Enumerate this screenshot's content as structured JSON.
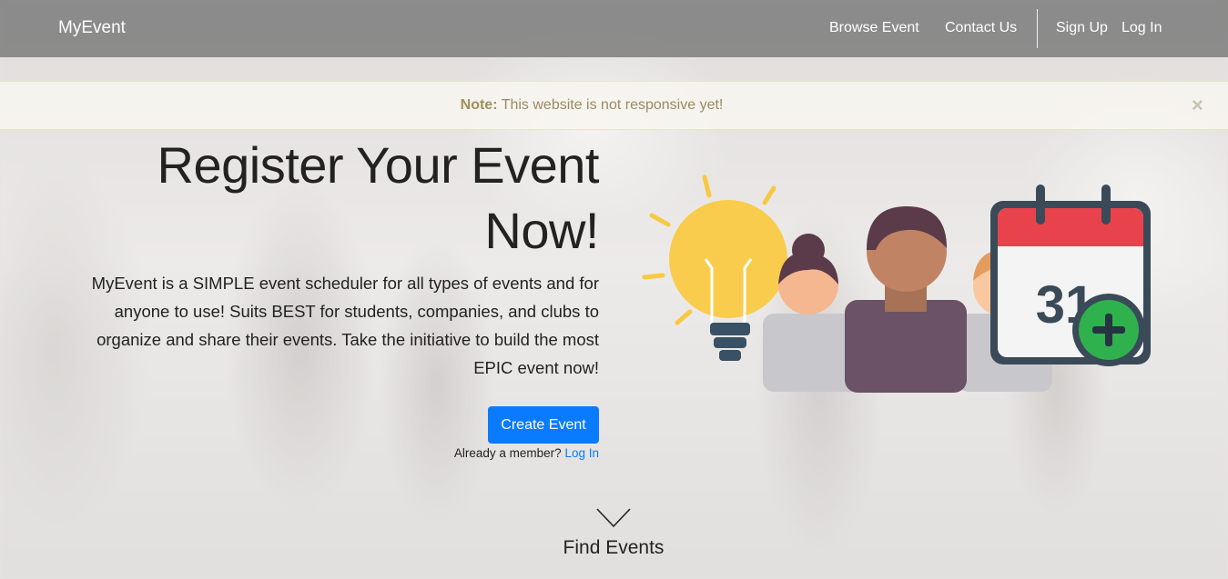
{
  "navbar": {
    "brand": "MyEvent",
    "links": [
      "Browse Event",
      "Contact Us"
    ],
    "auth": [
      "Sign Up",
      "Log In"
    ]
  },
  "alert": {
    "strong": "Note:",
    "message": "This website is not responsive yet!",
    "close": "×"
  },
  "hero": {
    "title_line1": "Register Your Event",
    "title_line2": "Now!",
    "description": "MyEvent is a SIMPLE event scheduler for all types of events and for anyone to use! Suits BEST for students, companies, and clubs to organize and share their events. Take the initiative to build the most EPIC event now!",
    "cta": "Create Event",
    "member_prompt": "Already a member?",
    "member_link": "Log In"
  },
  "illustration": {
    "calendar_day": "31",
    "icons": [
      "lightbulb-icon",
      "people-icon",
      "calendar-add-icon"
    ]
  },
  "scroll": {
    "label": "Find Events"
  },
  "colors": {
    "primary": "#0a7bff",
    "navbar": "#808080",
    "alert_text": "#9a8a60",
    "calendar_red": "#e8434d",
    "plus_green": "#2fb14e",
    "bulb_yellow": "#f9cc4e"
  }
}
